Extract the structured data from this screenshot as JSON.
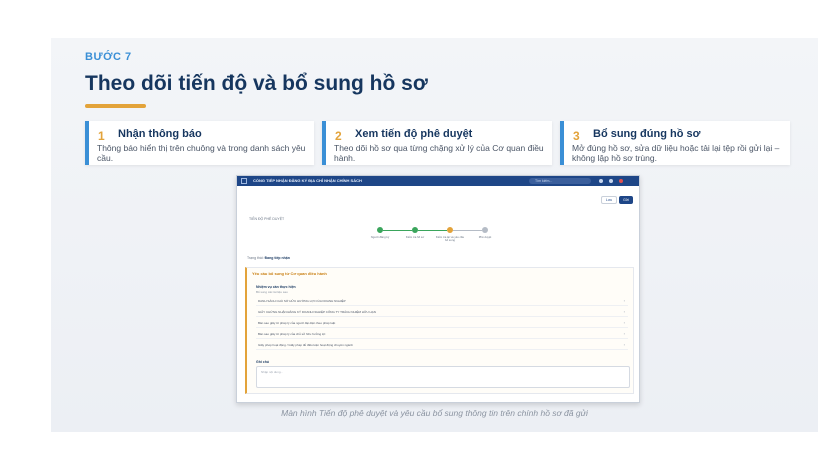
{
  "step_label": "BƯỚC 7",
  "title": "Theo dõi tiến độ và bổ sung hồ sơ",
  "cards": [
    {
      "num": "1",
      "title": "Nhận thông báo",
      "desc": "Thông báo hiển thị trên chuông và trong danh sách yêu cầu."
    },
    {
      "num": "2",
      "title": "Xem tiến độ phê duyệt",
      "desc": "Theo dõi hồ sơ qua từng chặng xử lý của Cơ quan điều hành."
    },
    {
      "num": "3",
      "title": "Bổ sung đúng hồ sơ",
      "desc": "Mở đúng hồ sơ, sửa dữ liệu hoặc tải lại tệp rồi gửi lại – không lập hồ sơ trùng."
    }
  ],
  "screenshot": {
    "app_title": "CỔNG TIẾP NHẬN ĐĂNG KÝ ĐỊA CHỈ NHẬN CHÍNH SÁCH",
    "search_placeholder": "Tìm kiếm...",
    "btn_back": "Lưu",
    "btn_save": "Gửi",
    "section_label": "TIẾN ĐỘ PHÊ DUYỆT",
    "steps": [
      {
        "label": "Người đăng ký",
        "status": "done",
        "color": "#3aa55c"
      },
      {
        "label": "Kiểm tra hồ sơ",
        "status": "done",
        "color": "#3aa55c"
      },
      {
        "label": "Kiểm tra lại và yêu cầu bổ sung",
        "status": "current",
        "color": "#e3a33a"
      },
      {
        "label": "Phê duyệt",
        "status": "pending",
        "color": "#b5bcc6"
      }
    ],
    "status_prefix": "Trạng thái:",
    "status_value": "Đang tiếp nhận",
    "panel_heading": "Yêu cầu bổ sung từ Cơ quan điều hành",
    "request_title": "Nhiệm vụ cần thực hiện",
    "request_sub": "Bổ sung các tài liệu sau",
    "documents": [
      "DANH SÁCH CHỦ SỞ HỮU HƯỞNG LỢI CỦA DOANH NGHIỆP",
      "GIẤY CHỨNG NHẬN ĐĂNG KÝ DOANH NGHIỆP CÔNG TY TRÁCH NHIỆM HỮU HẠN",
      "Bản sao giấy tờ pháp lý của người đại diện theo pháp luật",
      "Bản sao giấy tờ pháp lý của chủ sở hữu hưởng lợi",
      "Giấy phép hoạt động / Giấy phép đủ điều kiện hoạt động chuyên ngành"
    ],
    "note_label": "Ghi chú",
    "note_placeholder": "Nhập nội dung..."
  },
  "caption": "Màn hình Tiến độ phê duyệt và yêu cầu bổ sung thông tin trên chính hồ sơ đã gửi"
}
